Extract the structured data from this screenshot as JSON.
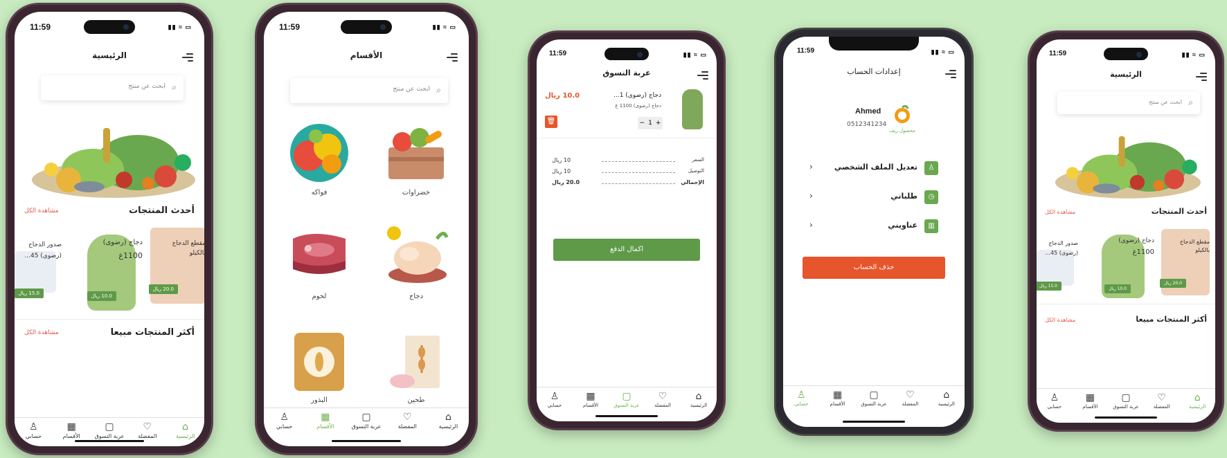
{
  "colors": {
    "background": "#c8ecc0",
    "accent_green": "#5e9a48",
    "active_tab": "#6ab04c",
    "link_red": "#e45a4a",
    "danger": "#e7552c"
  },
  "status": {
    "time": "11:59",
    "icons": "▮▮ ≈ ▭"
  },
  "tabs": {
    "home": "الرئيسية",
    "favorites": "المفضلة",
    "cart": "عربة التسوق",
    "categories": "الأقسام",
    "account": "حسابي"
  },
  "tab_icons": {
    "home": "home-icon",
    "favorites": "heart-icon",
    "cart": "bag-icon",
    "categories": "grid-icon",
    "account": "person-icon"
  },
  "home": {
    "title": "الرئيسية",
    "search_placeholder": "ابحث عن منتج",
    "latest_title": "أحدث المنتجات",
    "see_all": "مشاهدة الكل",
    "best_title": "أكثر المنتجات مبيعا",
    "products": [
      {
        "name": "دجاج (رضوى)",
        "weight": "1100غ",
        "price": "10.0 ريال"
      },
      {
        "name": "صدور الدجاج",
        "name2": "(رضوى) 45...",
        "price": "15.0 ريال"
      },
      {
        "name": "مقطع الدجاج",
        "name2": "بالكيلو",
        "price": "20.0 ريال"
      }
    ]
  },
  "categories": {
    "title": "الأقسام",
    "search_placeholder": "ابحث عن منتج",
    "items": [
      {
        "label": "خضراوات"
      },
      {
        "label": "فواكه"
      },
      {
        "label": "دجاج"
      },
      {
        "label": "لحوم"
      },
      {
        "label": "طحين"
      },
      {
        "label": "البذور"
      }
    ]
  },
  "cart": {
    "title": "عربة التسوق",
    "item_name": "دجاج (رضوى) 1...",
    "item_sub": "دجاج (رضوى) 1100 غ",
    "item_price": "10.0 ريال",
    "qty": "1",
    "minus": "−",
    "plus": "+",
    "rows": [
      {
        "label": "السعر",
        "value": "10 ريال"
      },
      {
        "label": "التوصيل",
        "value": "10 ريال"
      },
      {
        "label": "الإجمالي",
        "value": "20.0 ريال"
      }
    ],
    "checkout": "اكمال الدفع"
  },
  "account": {
    "title": "إعدادات الحساب",
    "name": "Ahmed",
    "phone": "0512341234",
    "logo_text": "محصول ريف",
    "items": [
      {
        "label": "تعديل الملف الشخصي",
        "icon": "person-icon"
      },
      {
        "label": "طلباتي",
        "icon": "clock-icon"
      },
      {
        "label": "عناويني",
        "icon": "map-icon"
      }
    ],
    "delete": "حذف الحساب"
  }
}
